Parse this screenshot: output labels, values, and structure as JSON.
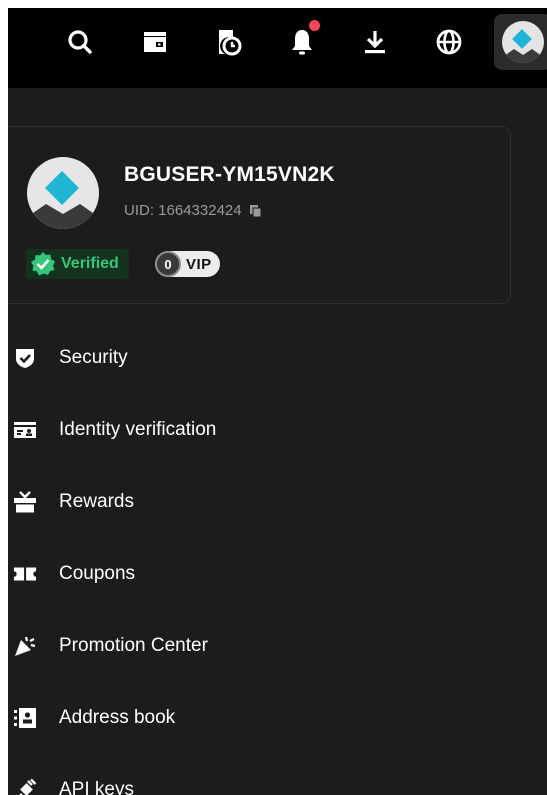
{
  "toolbar": {
    "icons": [
      "search-icon",
      "wallet-icon",
      "orders-history-icon",
      "bell-icon",
      "download-icon",
      "globe-icon",
      "avatar"
    ],
    "notification_dot_color": "#f1455b"
  },
  "profile": {
    "username": "BGUSER-YM15VN2K",
    "uid": "UID: 1664332424",
    "verified_label": "Verified",
    "vip_level": "0",
    "vip_label": "VIP"
  },
  "menu": {
    "items": [
      {
        "label": "Security",
        "icon": "shield-check-icon"
      },
      {
        "label": "Identity verification",
        "icon": "id-card-icon"
      },
      {
        "label": "Rewards",
        "icon": "gift-icon"
      },
      {
        "label": "Coupons",
        "icon": "ticket-icon"
      },
      {
        "label": "Promotion Center",
        "icon": "party-popper-icon"
      },
      {
        "label": "Address book",
        "icon": "address-book-icon"
      },
      {
        "label": "API keys",
        "icon": "plug-icon"
      }
    ]
  },
  "colors": {
    "background": "#1c1c1c",
    "topbar": "#000000",
    "accent_avatar": "#1fb5d5",
    "verified_green": "#34c77b"
  }
}
